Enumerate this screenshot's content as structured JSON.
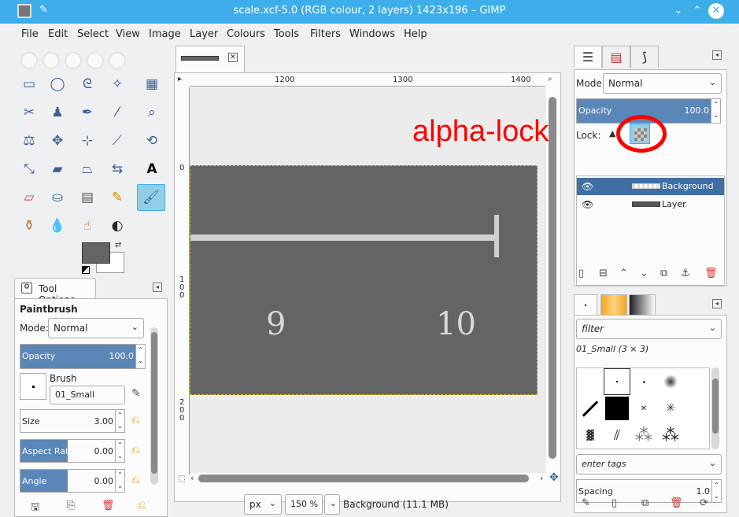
{
  "window": {
    "title": "scale.xcf-5.0 (RGB colour, 2 layers) 1423x196 – GIMP",
    "min": "⌄",
    "max": "⌃",
    "close": "✕"
  },
  "menu": [
    "File",
    "Edit",
    "Select",
    "View",
    "Image",
    "Layer",
    "Colours",
    "Tools",
    "Filters",
    "Windows",
    "Help"
  ],
  "tool_options": {
    "tab_label": "Tool Options",
    "tool_name": "Paintbrush",
    "mode_label": "Mode:",
    "mode_value": "Normal",
    "opacity_label": "Opacity",
    "opacity_value": "100.0",
    "brush_label": "Brush",
    "brush_value": "01_Small",
    "size_label": "Size",
    "size_value": "3.00",
    "aspect_label": "Aspect Ratio",
    "aspect_value": "0.00",
    "angle_label": "Angle",
    "angle_value": "0.00"
  },
  "canvas": {
    "ruler_h": [
      "1200",
      "1300",
      "1400"
    ],
    "ruler_v_top": "0",
    "ruler_v_mid": [
      "1",
      "0",
      "0"
    ],
    "ruler_v_bot": [
      "2",
      "0",
      "0"
    ],
    "label_9": "9",
    "label_10": "10"
  },
  "status": {
    "unit": "px",
    "zoom": "150 %",
    "info": "Background (11.1 MB)"
  },
  "layers": {
    "mode_label": "Mode:",
    "mode_value": "Normal",
    "opacity_label": "Opacity",
    "opacity_value": "100.0",
    "lock_label": "Lock:",
    "items": [
      {
        "name": "Background",
        "selected": true
      },
      {
        "name": "Layer",
        "selected": false
      }
    ]
  },
  "annotation": "alpha-lock",
  "brushes": {
    "filter_placeholder": "filter",
    "current": "01_Small (3 × 3)",
    "tags_placeholder": "enter tags",
    "spacing_label": "Spacing",
    "spacing_value": "1.0"
  },
  "colors": {
    "titlebar": "#3daee9",
    "selection": "#3f6fa4",
    "annotation": "#ff0000",
    "image_gray": "#646464"
  }
}
